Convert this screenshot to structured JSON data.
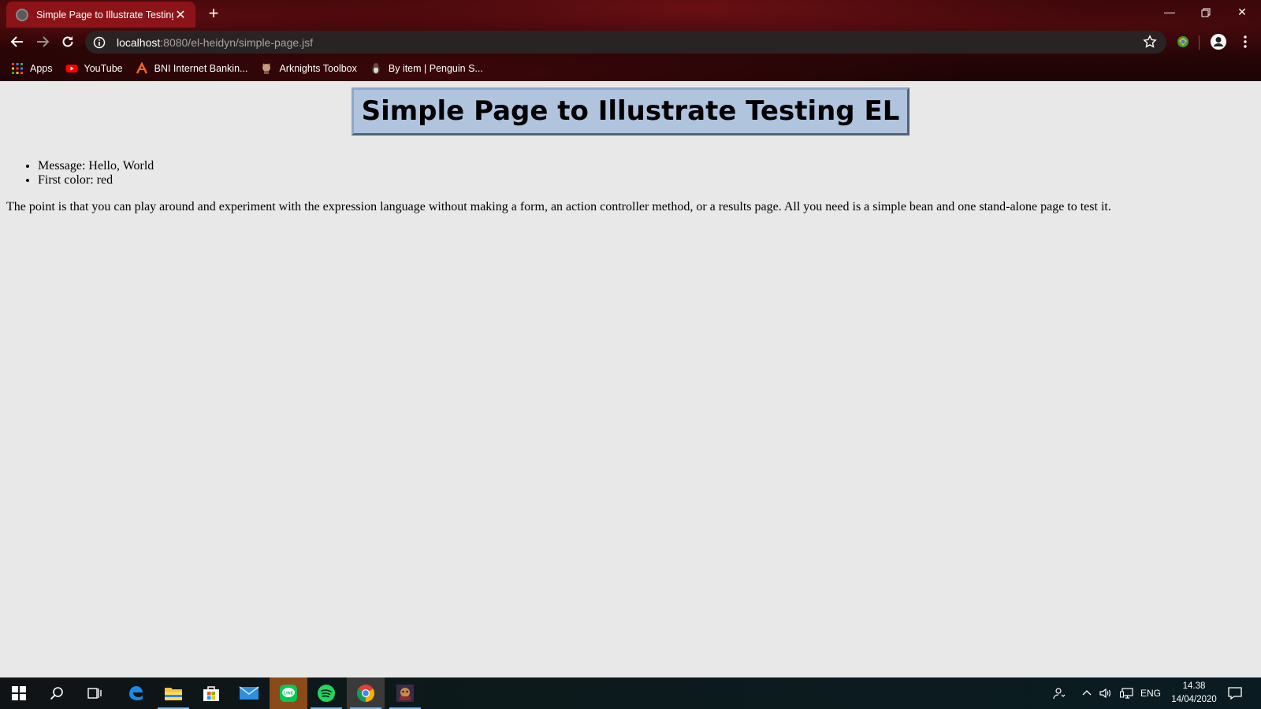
{
  "browser": {
    "tab_title": "Simple Page to Illustrate Testing EL",
    "new_tab_icon": "plus-icon",
    "url_host": "localhost",
    "url_rest": ":8080/el-heidyn/simple-page.jsf",
    "bookmarks": [
      {
        "label": "Apps",
        "icon": "apps-grid-icon"
      },
      {
        "label": "YouTube",
        "icon": "youtube-icon"
      },
      {
        "label": "BNI Internet Bankin...",
        "icon": "bni-icon"
      },
      {
        "label": "Arknights Toolbox",
        "icon": "arknights-icon"
      },
      {
        "label": "By item | Penguin S...",
        "icon": "penguin-icon"
      }
    ]
  },
  "page": {
    "title": "Simple Page to Illustrate Testing EL",
    "items": [
      "Message: Hello, World",
      "First color: red"
    ],
    "description": "The point is that you can play around and experiment with the expression language without making a form, an action controller method, or a results page. All you need is a simple bean and one stand-alone page to test it."
  },
  "taskbar": {
    "language": "ENG",
    "time": "14.38",
    "date": "14/04/2020"
  },
  "colors": {
    "title_bg": "#b0c4de",
    "page_bg": "#e8e8e8",
    "tab_active": "#8c1418"
  }
}
